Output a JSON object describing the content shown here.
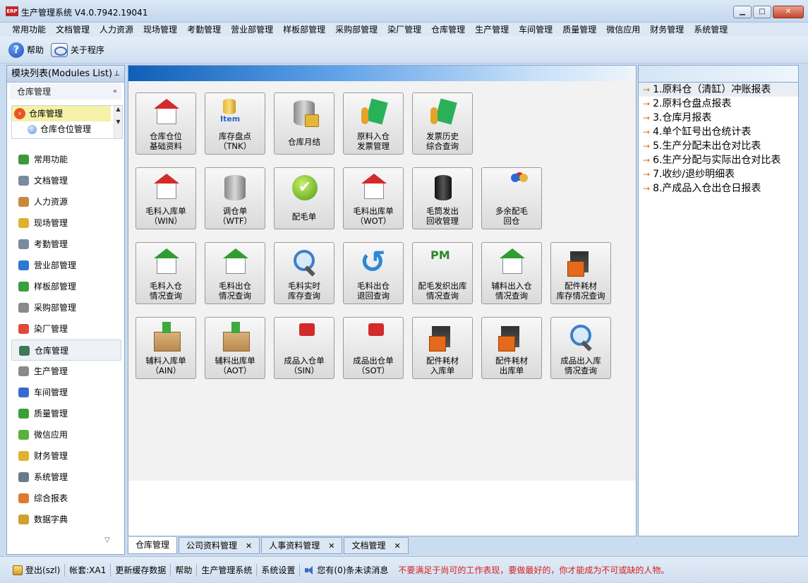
{
  "window": {
    "title": "生产管理系统 V4.0.7942.19041",
    "logo_text": "ERP"
  },
  "menubar": [
    "常用功能",
    "文档管理",
    "人力资源",
    "现场管理",
    "考勤管理",
    "营业部管理",
    "样板部管理",
    "采购部管理",
    "染厂管理",
    "仓库管理",
    "生产管理",
    "车间管理",
    "质量管理",
    "微信应用",
    "财务管理",
    "系统管理"
  ],
  "toolbar": {
    "help": "帮助",
    "about": "关于程序"
  },
  "left_panel": {
    "header": "模块列表(Modules List)",
    "section": "仓库管理",
    "tree": [
      {
        "label": "仓库管理"
      },
      {
        "label": "仓库仓位管理"
      }
    ],
    "modules": [
      {
        "label": "常用功能",
        "color": "#3a9a3a"
      },
      {
        "label": "文档管理",
        "color": "#7a8aa0"
      },
      {
        "label": "人力资源",
        "color": "#c88a3a"
      },
      {
        "label": "现场管理",
        "color": "#e0b030"
      },
      {
        "label": "考勤管理",
        "color": "#7a8aa0"
      },
      {
        "label": "营业部管理",
        "color": "#2a7ad0"
      },
      {
        "label": "样板部管理",
        "color": "#3aa03a"
      },
      {
        "label": "采购部管理",
        "color": "#8a8a8a"
      },
      {
        "label": "染厂管理",
        "color": "#e04a3a"
      },
      {
        "label": "仓库管理",
        "color": "#3a7a5a"
      },
      {
        "label": "生产管理",
        "color": "#8a8a8a"
      },
      {
        "label": "车间管理",
        "color": "#3a6ad0"
      },
      {
        "label": "质量管理",
        "color": "#3aa03a"
      },
      {
        "label": "微信应用",
        "color": "#5ab03a"
      },
      {
        "label": "财务管理",
        "color": "#e0b030"
      },
      {
        "label": "系统管理",
        "color": "#6a7a8a"
      },
      {
        "label": "综合报表",
        "color": "#e07a2a"
      },
      {
        "label": "数据字典",
        "color": "#d0a030"
      }
    ]
  },
  "tiles": [
    {
      "l1": "仓库仓位",
      "l2": "基础资料",
      "icon": "house-icon"
    },
    {
      "l1": "库存盘点",
      "l2": "（TNK）",
      "icon": "item-icon"
    },
    {
      "l1": "仓库月结",
      "l2": "",
      "icon": "database-lock-icon"
    },
    {
      "l1": "原料入仓",
      "l2": "发票管理",
      "icon": "ticket-icon"
    },
    {
      "l1": "发票历史",
      "l2": "综合查询",
      "icon": "ticket-icon"
    },
    {
      "l1": "毛料入库单",
      "l2": "（WIN）",
      "icon": "database-house-icon"
    },
    {
      "l1": "调仓单",
      "l2": "（WTF）",
      "icon": "transfer-icon"
    },
    {
      "l1": "配毛单",
      "l2": "",
      "icon": "check-icon"
    },
    {
      "l1": "毛料出库单",
      "l2": "（WOT）",
      "icon": "database-house-icon"
    },
    {
      "l1": "毛筒发出",
      "l2": "回收管理",
      "icon": "bin-icon"
    },
    {
      "l1": "多余配毛",
      "l2": "回仓",
      "icon": "balls-house-icon"
    },
    {
      "l1": "毛料入仓",
      "l2": "情况查询",
      "icon": "house-search-icon"
    },
    {
      "l1": "毛料出仓",
      "l2": "情况查询",
      "icon": "house-search-icon"
    },
    {
      "l1": "毛料实时",
      "l2": "库存查询",
      "icon": "search-icon"
    },
    {
      "l1": "毛料出仓",
      "l2": "退回查询",
      "icon": "refresh-icon"
    },
    {
      "l1": "配毛发织出库",
      "l2": "情况查询",
      "icon": "pm-icon"
    },
    {
      "l1": "辅料出入仓",
      "l2": "情况查询",
      "icon": "house-search-icon"
    },
    {
      "l1": "配件耗材",
      "l2": "库存情况查询",
      "icon": "forklift-icon"
    },
    {
      "l1": "辅料入库单",
      "l2": "（AIN）",
      "icon": "box-in-icon"
    },
    {
      "l1": "辅料出库单",
      "l2": "（AOT）",
      "icon": "box-out-icon"
    },
    {
      "l1": "成品入仓单",
      "l2": "（SIN）",
      "icon": "shirt-house-icon"
    },
    {
      "l1": "成品出仓单",
      "l2": "（SOT）",
      "icon": "shirt-house-icon"
    },
    {
      "l1": "配件耗材",
      "l2": "入库单",
      "icon": "forklift-icon"
    },
    {
      "l1": "配件耗材",
      "l2": "出库单",
      "icon": "forklift-icon"
    },
    {
      "l1": "成品出入库",
      "l2": "情况查询",
      "icon": "shirt-search-icon"
    }
  ],
  "reports": [
    "1.原料仓（清缸）冲账报表",
    "2.原料仓盘点报表",
    "3.仓库月报表",
    "4.单个缸号出仓统计表",
    "5.生产分配未出仓对比表",
    "6.生产分配与实际出仓对比表",
    "7.收纱/退纱明细表",
    "8.产成品入仓出仓日报表"
  ],
  "tabs": [
    {
      "label": "仓库管理",
      "closable": false
    },
    {
      "label": "公司资料管理",
      "closable": true
    },
    {
      "label": "人事资料管理",
      "closable": true
    },
    {
      "label": "文档管理",
      "closable": true
    }
  ],
  "statusbar": {
    "logout": "登出(szl)",
    "account": "帐套:XA1",
    "refresh_cache": "更新缓存数据",
    "help": "帮助",
    "system": "生产管理系统",
    "settings": "系统设置",
    "messages": "您有(0)条未读消息",
    "motto": "不要满足于尚可的工作表现，要做最好的，你才能成为不可或缺的人物。"
  }
}
